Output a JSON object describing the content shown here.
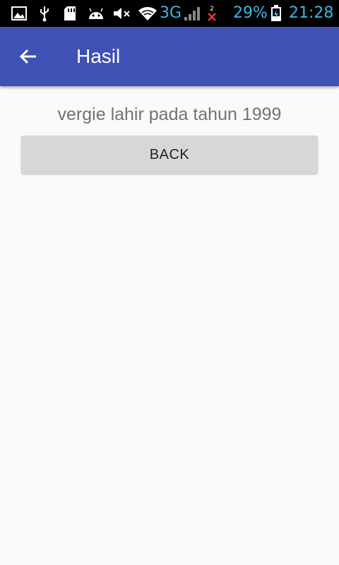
{
  "status_bar": {
    "network": "3G",
    "sim_notification_count": "2",
    "battery": "29%",
    "time": "21:28",
    "icons": [
      "gallery-icon",
      "usb-icon",
      "sd-card-icon",
      "android-icon",
      "mute-icon",
      "wifi-icon",
      "signal-icon",
      "no-sim-icon",
      "battery-charging-icon"
    ]
  },
  "app_bar": {
    "title": "Hasil",
    "back_icon": "arrow-back-icon",
    "color": "#3f51b5"
  },
  "content": {
    "result_text": "vergie lahir pada tahun 1999",
    "back_button_label": "BACK"
  }
}
